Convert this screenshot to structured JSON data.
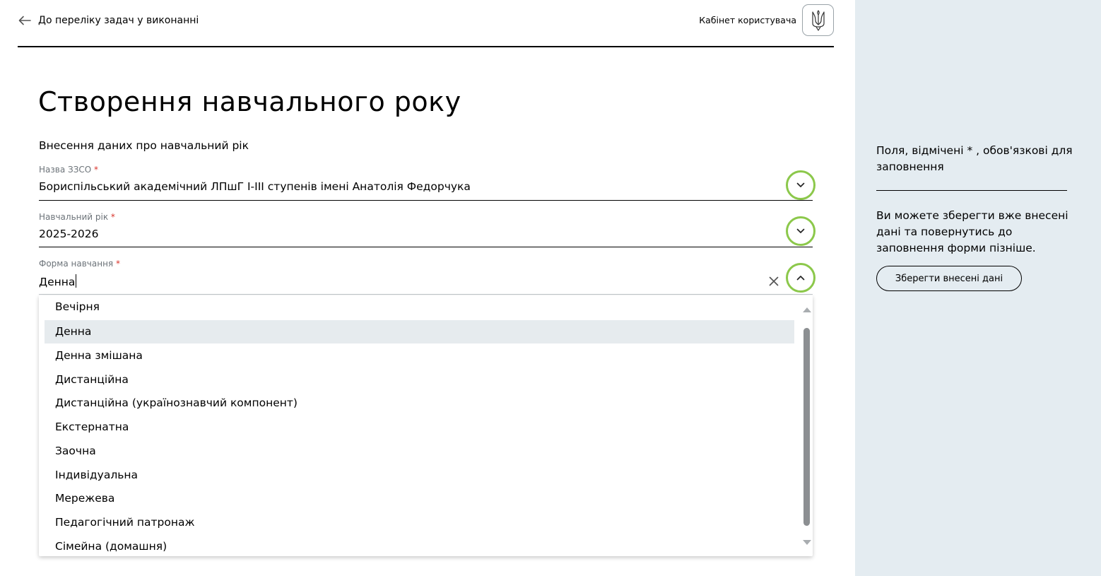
{
  "header": {
    "back_label": "До переліку задач у виконанні",
    "cabinet_label": "Кабінет користувача",
    "emblem_icon": "trident-icon"
  },
  "main": {
    "title": "Створення навчального року",
    "subtitle": "Внесення даних про навчальний рік"
  },
  "fields": {
    "school": {
      "label": "Назва ЗЗСО",
      "required_mark": "*",
      "value": "Бориспільський академічний ЛПшГ І-ІІІ ступенів імені Анатолія Федорчука"
    },
    "year": {
      "label": "Навчальний рік",
      "required_mark": "*",
      "value": "2025-2026"
    },
    "form": {
      "label": "Форма навчання",
      "required_mark": "*",
      "value": "Денна"
    }
  },
  "dropdown": {
    "options": [
      "Вечірня",
      "Денна",
      "Денна змішана",
      "Дистанційна",
      "Дистанційна (українознавчий компонент)",
      "Екстернатна",
      "Заочна",
      "Індивідуальна",
      "Мережева",
      "Педагогічний патронаж",
      "Сімейна (домашня)"
    ],
    "selected": "Денна"
  },
  "side": {
    "required_note": "Поля, відмічені * , обов'язкові для заповнення",
    "save_info": "Ви можете зберегти вже внесені дані та повернутись до заповнення форми пізніше.",
    "save_button": "Зберегти внесені дані"
  },
  "colors": {
    "side_background": "#e4ecf1",
    "focus_ring": "#8cc84b",
    "required_asterisk": "#d9342b",
    "selected_option": "#e6ebee"
  }
}
